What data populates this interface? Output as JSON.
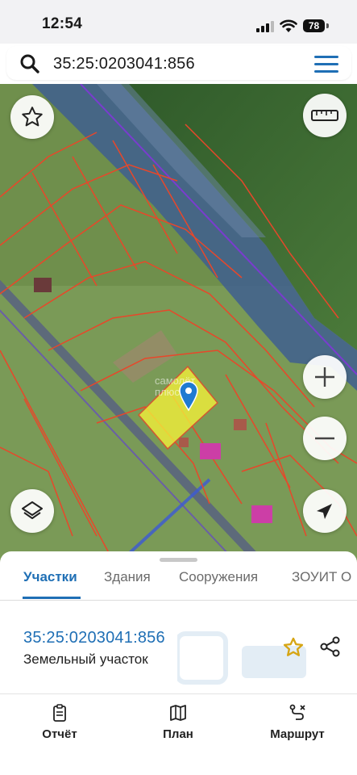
{
  "status": {
    "time": "12:54",
    "battery": "78"
  },
  "search": {
    "query": "35:25:0203041:856"
  },
  "map": {
    "watermark": "самолёт",
    "watermark_sub": "плюс",
    "colors": {
      "parcel_line": "#e8472a",
      "parcel_fill": "#f2ef3a",
      "river": "#3f5f8f",
      "pin": "#1f7ad1"
    }
  },
  "sheet": {
    "tabs": [
      {
        "label": "Участки",
        "active": true
      },
      {
        "label": "Здания",
        "active": false
      },
      {
        "label": "Сооружения",
        "active": false
      },
      {
        "label": "ЗОУИТ О",
        "active": false
      }
    ],
    "parcel": {
      "number": "35:25:0203041:856",
      "type": "Земельный участок"
    }
  },
  "nav": [
    {
      "label": "Отчёт",
      "icon": "report-icon"
    },
    {
      "label": "План",
      "icon": "map-plan-icon"
    },
    {
      "label": "Маршрут",
      "icon": "route-icon"
    }
  ]
}
